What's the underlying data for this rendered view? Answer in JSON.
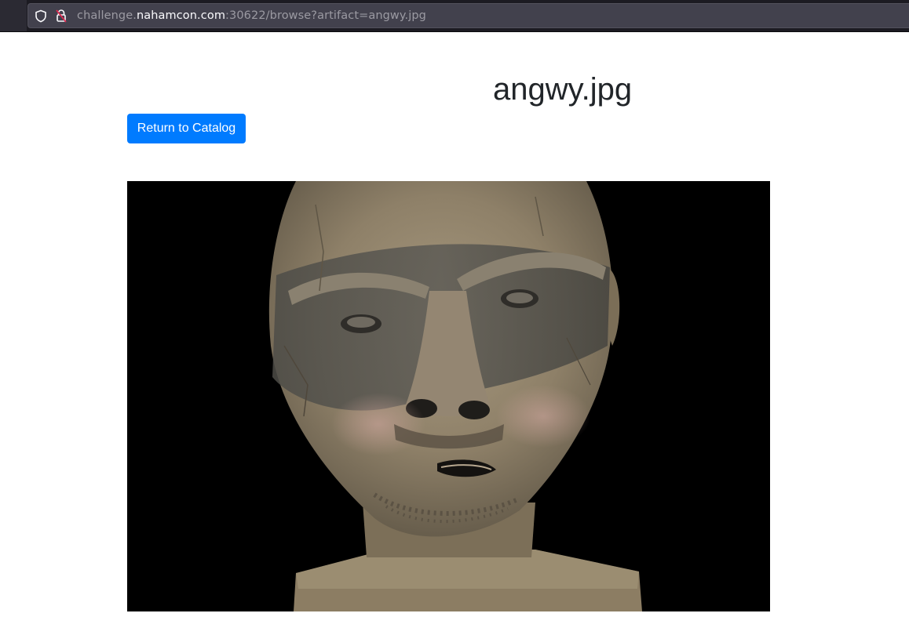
{
  "browser": {
    "url_prefix": "challenge.",
    "url_host": "nahamcon.com",
    "url_rest": ":30622/browse?artifact=angwy.jpg"
  },
  "page": {
    "title": "angwy.jpg",
    "return_button_label": "Return to Catalog"
  },
  "artifact_image": {
    "subject": "weathered carved wooden figure head with frowning face on black background",
    "background_color": "#000000"
  },
  "colors": {
    "button_primary": "#007bff",
    "title_text": "#212529",
    "chrome_bg": "#1c1b22",
    "urlbar_bg": "#42414d"
  }
}
